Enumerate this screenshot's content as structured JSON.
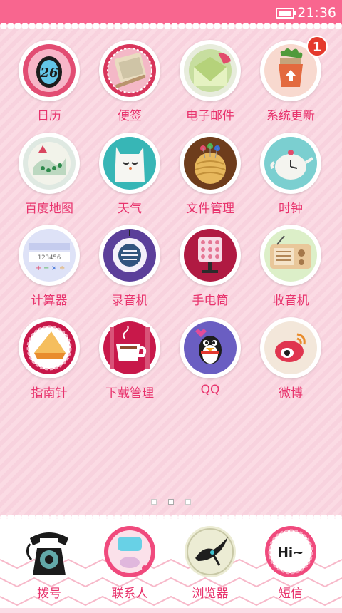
{
  "status": {
    "time": "21:36"
  },
  "apps": [
    {
      "label": "日历",
      "icon": "calendar-icon",
      "date": "26"
    },
    {
      "label": "便签",
      "icon": "notes-icon"
    },
    {
      "label": "电子邮件",
      "icon": "email-icon"
    },
    {
      "label": "系统更新",
      "icon": "system-update-icon",
      "badge": "1"
    },
    {
      "label": "百度地图",
      "icon": "map-icon"
    },
    {
      "label": "天气",
      "icon": "weather-icon"
    },
    {
      "label": "文件管理",
      "icon": "file-manager-icon"
    },
    {
      "label": "时钟",
      "icon": "clock-icon"
    },
    {
      "label": "计算器",
      "icon": "calculator-icon"
    },
    {
      "label": "录音机",
      "icon": "recorder-icon"
    },
    {
      "label": "手电筒",
      "icon": "flashlight-icon"
    },
    {
      "label": "收音机",
      "icon": "radio-icon"
    },
    {
      "label": "指南针",
      "icon": "compass-icon"
    },
    {
      "label": "下载管理",
      "icon": "download-manager-icon"
    },
    {
      "label": "QQ",
      "icon": "qq-penguin-icon"
    },
    {
      "label": "微博",
      "icon": "weibo-icon"
    }
  ],
  "dock": [
    {
      "label": "拨号",
      "icon": "telephone-icon"
    },
    {
      "label": "联系人",
      "icon": "contacts-icon"
    },
    {
      "label": "浏览器",
      "icon": "browser-icon"
    },
    {
      "label": "短信",
      "icon": "sms-icon",
      "text": "Hi~"
    }
  ],
  "colors": {
    "accent": "#e8336d",
    "statusbar": "#f8668f",
    "background": "#fbdde6"
  }
}
